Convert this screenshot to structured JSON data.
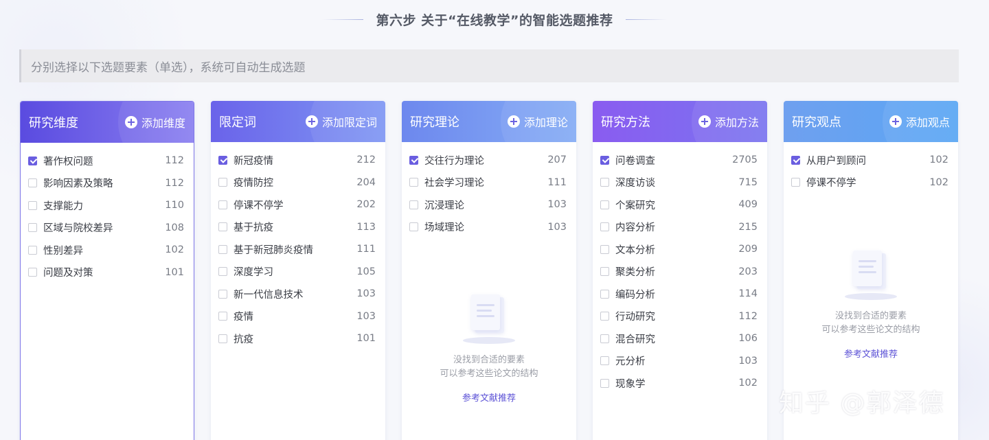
{
  "page": {
    "title": "第六步 关于“在线教学”的智能选题推荐",
    "hint": "分别选择以下选题要素（单选），系统可自动生成选题"
  },
  "panels": [
    {
      "title": "研究维度",
      "add_label": "添加维度",
      "header_gradient": [
        "#5a4be0",
        "#8a7ff0"
      ],
      "items": [
        {
          "label": "著作权问题",
          "count": "112",
          "checked": true
        },
        {
          "label": "影响因素及策略",
          "count": "112",
          "checked": false
        },
        {
          "label": "支撑能力",
          "count": "110",
          "checked": false
        },
        {
          "label": "区域与院校差异",
          "count": "108",
          "checked": false
        },
        {
          "label": "性别差异",
          "count": "102",
          "checked": false
        },
        {
          "label": "问题及对策",
          "count": "101",
          "checked": false
        }
      ]
    },
    {
      "title": "限定词",
      "add_label": "添加限定词",
      "header_gradient": [
        "#6a63ea",
        "#7f97f3"
      ],
      "items": [
        {
          "label": "新冠疫情",
          "count": "212",
          "checked": true
        },
        {
          "label": "疫情防控",
          "count": "204",
          "checked": false
        },
        {
          "label": "停课不停学",
          "count": "202",
          "checked": false
        },
        {
          "label": "基于抗疫",
          "count": "113",
          "checked": false
        },
        {
          "label": "基于新冠肺炎疫情",
          "count": "111",
          "checked": false
        },
        {
          "label": "深度学习",
          "count": "105",
          "checked": false
        },
        {
          "label": "新一代信息技术",
          "count": "103",
          "checked": false
        },
        {
          "label": "疫情",
          "count": "103",
          "checked": false
        },
        {
          "label": "抗疫",
          "count": "101",
          "checked": false
        }
      ]
    },
    {
      "title": "研究理论",
      "add_label": "添加理论",
      "header_gradient": [
        "#6d88ee",
        "#85acf5"
      ],
      "items": [
        {
          "label": "交往行为理论",
          "count": "207",
          "checked": true
        },
        {
          "label": "社会学习理论",
          "count": "111",
          "checked": false
        },
        {
          "label": "沉浸理论",
          "count": "103",
          "checked": false
        },
        {
          "label": "场域理论",
          "count": "103",
          "checked": false
        }
      ],
      "empty": {
        "line1": "没找到合适的要素",
        "line2": "可以参考这些论文的结构",
        "link": "参考文献推荐"
      }
    },
    {
      "title": "研究方法",
      "add_label": "添加方法",
      "header_gradient": [
        "#8a5cf0",
        "#7a74ef"
      ],
      "items": [
        {
          "label": "问卷调查",
          "count": "2705",
          "checked": true
        },
        {
          "label": "深度访谈",
          "count": "715",
          "checked": false
        },
        {
          "label": "个案研究",
          "count": "409",
          "checked": false
        },
        {
          "label": "内容分析",
          "count": "215",
          "checked": false
        },
        {
          "label": "文本分析",
          "count": "209",
          "checked": false
        },
        {
          "label": "聚类分析",
          "count": "203",
          "checked": false
        },
        {
          "label": "编码分析",
          "count": "114",
          "checked": false
        },
        {
          "label": "行动研究",
          "count": "112",
          "checked": false
        },
        {
          "label": "混合研究",
          "count": "106",
          "checked": false
        },
        {
          "label": "元分析",
          "count": "103",
          "checked": false
        },
        {
          "label": "现象学",
          "count": "102",
          "checked": false
        }
      ]
    },
    {
      "title": "研究观点",
      "add_label": "添加观点",
      "header_gradient": [
        "#6fa0ef",
        "#5aa6f4"
      ],
      "items": [
        {
          "label": "从用户到顾问",
          "count": "102",
          "checked": true
        },
        {
          "label": "停课不停学",
          "count": "102",
          "checked": false
        }
      ],
      "empty": {
        "line1": "没找到合适的要素",
        "line2": "可以参考这些论文的结构",
        "link": "参考文献推荐"
      }
    }
  ],
  "watermark": "知乎 @郭泽德"
}
